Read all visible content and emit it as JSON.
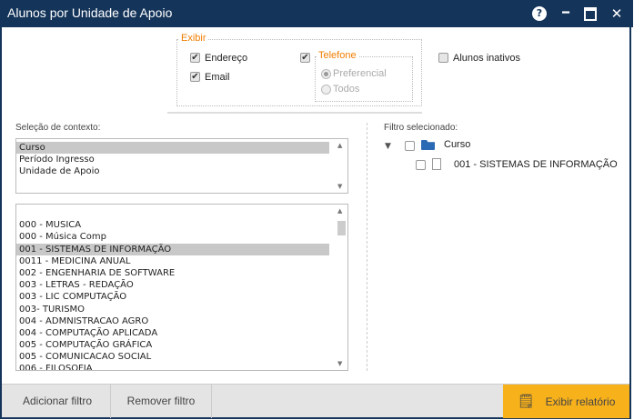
{
  "window": {
    "title": "Alunos por Unidade de Apoio"
  },
  "exibir": {
    "legend": "Exibir",
    "endereco": {
      "label": "Endereço",
      "checked": true
    },
    "email": {
      "label": "Email",
      "checked": true
    },
    "telefone_checked": true,
    "telefone": {
      "legend": "Telefone",
      "preferencial": "Preferencial",
      "todos": "Todos",
      "selected": "Preferencial"
    },
    "inativos": {
      "label": "Alunos inativos",
      "checked": false
    }
  },
  "contexto": {
    "label": "Seleção de contexto:",
    "items": [
      "Curso",
      "Período Ingresso",
      "Unidade de Apoio"
    ],
    "selected": "Curso"
  },
  "cursos": {
    "items": [
      "",
      "000 - MUSICA",
      "000 - Música Comp",
      "001 - SISTEMAS DE INFORMAÇÃO",
      "0011 - MEDICINA ANUAL",
      "002 - ENGENHARIA DE SOFTWARE",
      "003 - LETRAS - REDAÇÃO",
      "003 - LIC COMPUTAÇÃO",
      "003- TURISMO",
      "004 - ADMNISTRACAO AGRO",
      "004 - COMPUTAÇÃO APLICADA",
      "005 - COMPUTAÇÃO GRÁFICA",
      "005 - COMUNICACAO SOCIAL",
      "006 - FILOSOFIA"
    ],
    "selected": "001 - SISTEMAS DE INFORMAÇÃO"
  },
  "filtro": {
    "label": "Filtro selecionado:",
    "root": "Curso",
    "child": "001 - SISTEMAS DE INFORMAÇÃO"
  },
  "buttons": {
    "adicionar": "Adicionar filtro",
    "remover": "Remover filtro",
    "exibir": "Exibir relatório"
  },
  "colors": {
    "titlebar": "#14345a",
    "accent": "#f7b11b",
    "legend": "#f07d00"
  }
}
